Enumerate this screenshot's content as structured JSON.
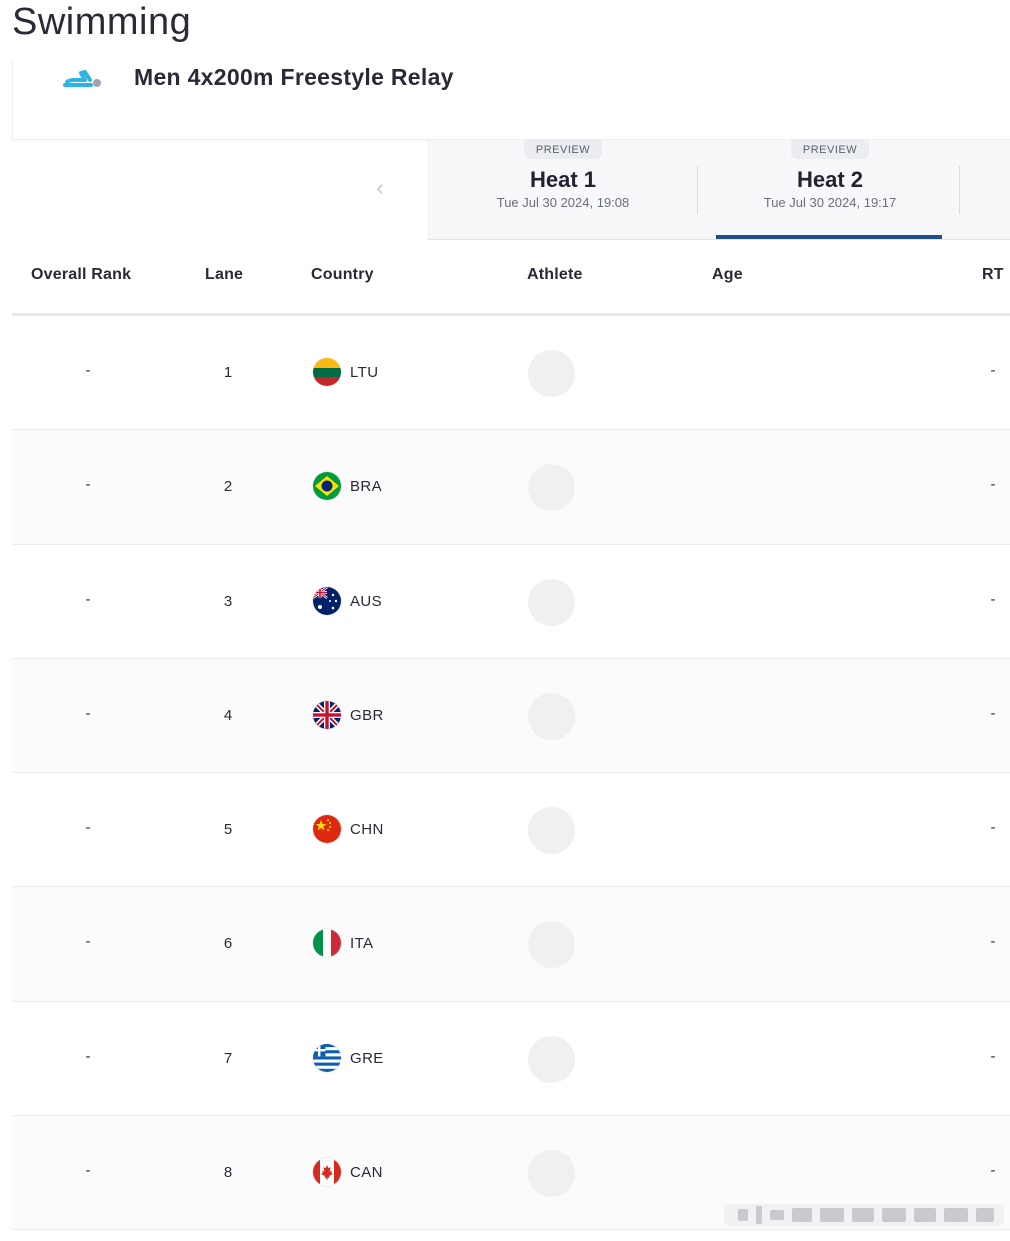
{
  "sport": "Swimming",
  "event": {
    "name": "Men 4x200m Freestyle Relay",
    "icon": "swimmer-icon",
    "accent": "#2bb5e0"
  },
  "heats": [
    {
      "badge": "PREVIEW",
      "label": "Heat 1",
      "date": "Tue Jul 30 2024, 19:08",
      "active": false
    },
    {
      "badge": "PREVIEW",
      "label": "Heat 2",
      "date": "Tue Jul 30 2024, 19:17",
      "active": true
    }
  ],
  "active_color": "#1e4c8c",
  "table": {
    "headers": {
      "rank": "Overall Rank",
      "lane": "Lane",
      "country": "Country",
      "athlete": "Athlete",
      "age": "Age",
      "rt": "RT"
    },
    "rows": [
      {
        "rank": "-",
        "lane": "1",
        "country": "LTU",
        "rt": "-"
      },
      {
        "rank": "-",
        "lane": "2",
        "country": "BRA",
        "rt": "-"
      },
      {
        "rank": "-",
        "lane": "3",
        "country": "AUS",
        "rt": "-"
      },
      {
        "rank": "-",
        "lane": "4",
        "country": "GBR",
        "rt": "-"
      },
      {
        "rank": "-",
        "lane": "5",
        "country": "CHN",
        "rt": "-"
      },
      {
        "rank": "-",
        "lane": "6",
        "country": "ITA",
        "rt": "-"
      },
      {
        "rank": "-",
        "lane": "7",
        "country": "GRE",
        "rt": "-"
      },
      {
        "rank": "-",
        "lane": "8",
        "country": "CAN",
        "rt": "-"
      }
    ]
  }
}
